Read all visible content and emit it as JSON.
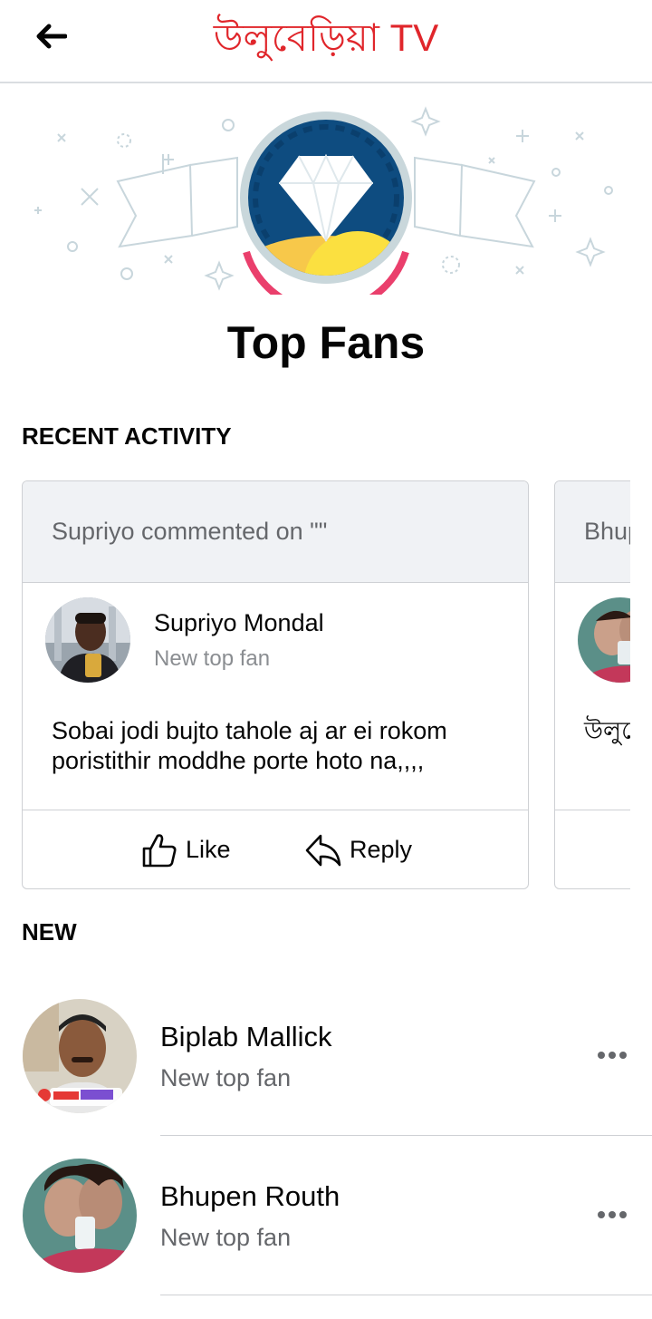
{
  "header": {
    "title": "উলুবেড়িয়া TV",
    "back_icon": "back-arrow-icon"
  },
  "hero": {
    "badge_icon": "diamond-badge-icon",
    "title": "Top Fans"
  },
  "sections": {
    "recent_activity": "RECENT ACTIVITY",
    "new": "NEW"
  },
  "activity_cards": [
    {
      "header": "Supriyo commented on \"\"",
      "name": "Supriyo Mondal",
      "subtitle": "New top fan",
      "comment": "Sobai jodi bujto tahole aj ar ei rokom poristithir moddhe porte hoto na,,,,",
      "like_label": "Like",
      "reply_label": "Reply"
    },
    {
      "header": "Bhup",
      "comment": "উলুবে"
    }
  ],
  "fans": [
    {
      "name": "Biplab Mallick",
      "subtitle": "New top fan"
    },
    {
      "name": "Bhupen Routh",
      "subtitle": "New top fan"
    }
  ],
  "colors": {
    "brand_red": "#e0262b",
    "badge_blue": "#0f4c81",
    "text_gray": "#65676b"
  }
}
